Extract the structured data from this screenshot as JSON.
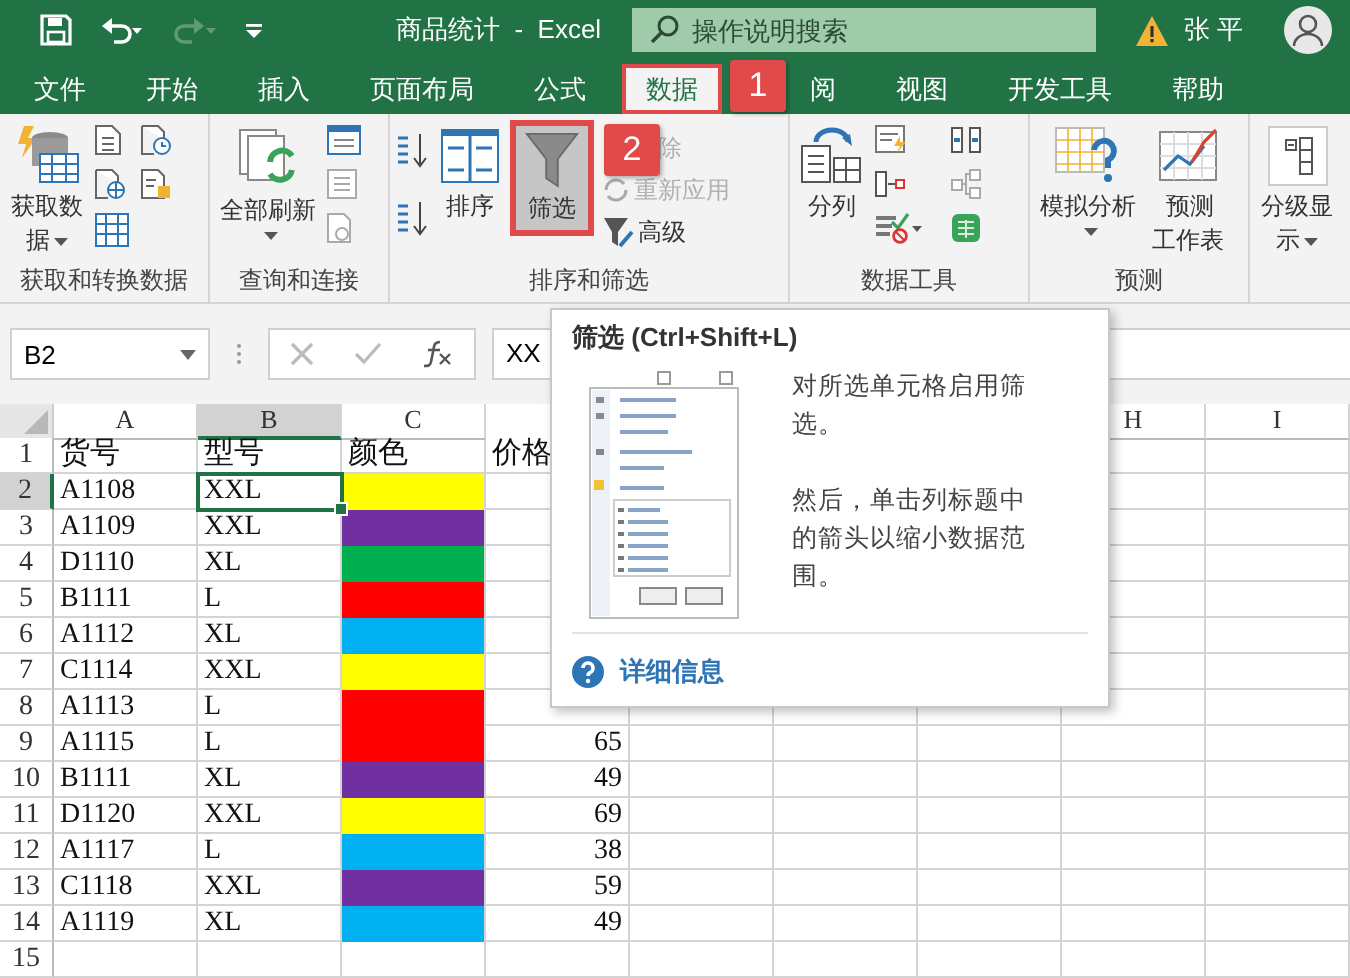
{
  "title_bar": {
    "title": "商品统计  -  Excel",
    "search": {
      "placeholder": "操作说明搜索"
    },
    "user": "张 平"
  },
  "tabs": [
    {
      "label": "文件",
      "selected": false
    },
    {
      "label": "开始",
      "selected": false
    },
    {
      "label": "插入",
      "selected": false
    },
    {
      "label": "页面布局",
      "selected": false
    },
    {
      "label": "公式",
      "selected": false
    },
    {
      "label": "数据",
      "selected": true,
      "callout": "1"
    },
    {
      "label": "阅",
      "selected": false
    },
    {
      "label": "视图",
      "selected": false
    },
    {
      "label": "开发工具",
      "selected": false
    },
    {
      "label": "帮助",
      "selected": false
    }
  ],
  "ribbon": {
    "groups": [
      {
        "label": "获取和转换数据",
        "commands": [
          {
            "label": "获取数据"
          }
        ]
      },
      {
        "label": "查询和连接",
        "commands": [
          {
            "label": "全部刷新"
          }
        ]
      },
      {
        "label": "排序和筛选",
        "commands": [
          {
            "label": "排序"
          },
          {
            "label": "筛选",
            "highlighted": true,
            "callout": "2"
          },
          {
            "label": "除",
            "disabled": true
          },
          {
            "label": "重新应用",
            "disabled": true
          },
          {
            "label": "高级",
            "disabled": false
          }
        ]
      },
      {
        "label": "数据工具",
        "commands": [
          {
            "label": "分列"
          }
        ]
      },
      {
        "label": "预测",
        "commands": [
          {
            "label": "模拟分析"
          },
          {
            "label": "预测工作表"
          }
        ]
      },
      {
        "commands": [
          {
            "label": "分级显示"
          }
        ]
      }
    ]
  },
  "formula_bar": {
    "name_box": "B2",
    "value": "XX"
  },
  "sheet": {
    "columns": [
      {
        "label": "A",
        "selected": false
      },
      {
        "label": "B",
        "selected": true
      },
      {
        "label": "C",
        "selected": false
      },
      {
        "label": "H",
        "selected": false
      },
      {
        "label": "I",
        "selected": false
      }
    ],
    "rows": [
      {
        "number": "1",
        "kind": "header",
        "selected": false,
        "item": "货号",
        "size": "型号",
        "color_label": "颜色",
        "price": "价格"
      },
      {
        "number": "2",
        "kind": "data",
        "selected": true,
        "item": "A1108",
        "size": "XXL",
        "color": "#ffff00"
      },
      {
        "number": "3",
        "kind": "data",
        "selected": false,
        "item": "A1109",
        "size": "XXL",
        "color": "#7030a0"
      },
      {
        "number": "4",
        "kind": "data",
        "selected": false,
        "item": "D1110",
        "size": "XL",
        "color": "#00b050"
      },
      {
        "number": "5",
        "kind": "data",
        "selected": false,
        "item": "B1111",
        "size": "L",
        "color": "#ff0000"
      },
      {
        "number": "6",
        "kind": "data",
        "selected": false,
        "item": "A1112",
        "size": "XL",
        "color": "#00b0f0"
      },
      {
        "number": "7",
        "kind": "data",
        "selected": false,
        "item": "C1114",
        "size": "XXL",
        "color": "#ffff00"
      },
      {
        "number": "8",
        "kind": "data",
        "selected": false,
        "item": "A1113",
        "size": "L",
        "color": "#ff0000"
      },
      {
        "number": "9",
        "kind": "data",
        "selected": false,
        "item": "A1115",
        "size": "L",
        "color": "#ff0000",
        "price": "65"
      },
      {
        "number": "10",
        "kind": "data",
        "selected": false,
        "item": "B1111",
        "size": "XL",
        "color": "#7030a0",
        "price": "49"
      },
      {
        "number": "11",
        "kind": "data",
        "selected": false,
        "item": "D1120",
        "size": "XXL",
        "color": "#ffff00",
        "price": "69"
      },
      {
        "number": "12",
        "kind": "data",
        "selected": false,
        "item": "A1117",
        "size": "L",
        "color": "#00b0f0",
        "price": "38"
      },
      {
        "number": "13",
        "kind": "data",
        "selected": false,
        "item": "C1118",
        "size": "XXL",
        "color": "#7030a0",
        "price": "59"
      },
      {
        "number": "14",
        "kind": "data",
        "selected": false,
        "item": "A1119",
        "size": "XL",
        "color": "#00b0f0",
        "price": "49"
      },
      {
        "number": "15",
        "kind": "empty",
        "selected": false
      }
    ]
  },
  "tooltip": {
    "title": "筛选 (Ctrl+Shift+L)",
    "text": [
      "对所选单元格启用筛选。",
      "然后，单击列标题中的箭头以缩小数据范围。"
    ],
    "link": "详细信息"
  }
}
